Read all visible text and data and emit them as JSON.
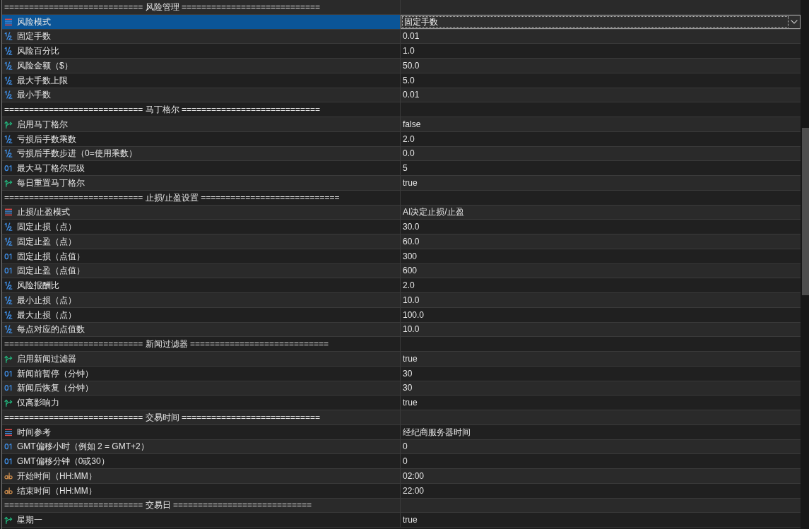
{
  "table": {
    "rows": [
      {
        "kind": "header",
        "label": "============================ 风险管理 ============================",
        "selected": false
      },
      {
        "kind": "enum",
        "label": "风险模式",
        "value": "固定手数",
        "selected": true
      },
      {
        "kind": "double",
        "label": "固定手数",
        "value": "0.01",
        "selected": false
      },
      {
        "kind": "double",
        "label": "风险百分比",
        "value": "1.0",
        "selected": false
      },
      {
        "kind": "double",
        "label": "风险金额（$）",
        "value": "50.0",
        "selected": false
      },
      {
        "kind": "double",
        "label": "最大手数上限",
        "value": "5.0",
        "selected": false
      },
      {
        "kind": "double",
        "label": "最小手数",
        "value": "0.01",
        "selected": false
      },
      {
        "kind": "header",
        "label": "============================ 马丁格尔 ============================",
        "selected": false
      },
      {
        "kind": "bool",
        "label": "启用马丁格尔",
        "value": "false",
        "selected": false
      },
      {
        "kind": "double",
        "label": "亏损后手数乘数",
        "value": "2.0",
        "selected": false
      },
      {
        "kind": "double",
        "label": "亏损后手数步进（0=使用乘数）",
        "value": "0.0",
        "selected": false
      },
      {
        "kind": "int",
        "label": "最大马丁格尔层级",
        "value": "5",
        "selected": false
      },
      {
        "kind": "bool",
        "label": "每日重置马丁格尔",
        "value": "true",
        "selected": false
      },
      {
        "kind": "header",
        "label": "============================ 止损/止盈设置 ============================",
        "selected": false
      },
      {
        "kind": "enum",
        "label": "止损/止盈模式",
        "value": "AI决定止损/止盈",
        "selected": false
      },
      {
        "kind": "double",
        "label": "固定止损（点）",
        "value": "30.0",
        "selected": false
      },
      {
        "kind": "double",
        "label": "固定止盈（点）",
        "value": "60.0",
        "selected": false
      },
      {
        "kind": "int",
        "label": "固定止损（点值）",
        "value": "300",
        "selected": false
      },
      {
        "kind": "int",
        "label": "固定止盈（点值）",
        "value": "600",
        "selected": false
      },
      {
        "kind": "double",
        "label": "风险报酬比",
        "value": "2.0",
        "selected": false
      },
      {
        "kind": "double",
        "label": "最小止损（点）",
        "value": "10.0",
        "selected": false
      },
      {
        "kind": "double",
        "label": "最大止损（点）",
        "value": "100.0",
        "selected": false
      },
      {
        "kind": "double",
        "label": "每点对应的点值数",
        "value": "10.0",
        "selected": false
      },
      {
        "kind": "header",
        "label": "============================ 新闻过滤器 ============================",
        "selected": false
      },
      {
        "kind": "bool",
        "label": "启用新闻过滤器",
        "value": "true",
        "selected": false
      },
      {
        "kind": "int",
        "label": "新闻前暂停（分钟）",
        "value": "30",
        "selected": false
      },
      {
        "kind": "int",
        "label": "新闻后恢复（分钟）",
        "value": "30",
        "selected": false
      },
      {
        "kind": "bool",
        "label": "仅高影响力",
        "value": "true",
        "selected": false
      },
      {
        "kind": "header",
        "label": "============================ 交易时间 ============================",
        "selected": false
      },
      {
        "kind": "enum",
        "label": "时间参考",
        "value": "经纪商服务器时间",
        "selected": false
      },
      {
        "kind": "int",
        "label": "GMT偏移小时（例如 2 = GMT+2）",
        "value": "0",
        "selected": false
      },
      {
        "kind": "int",
        "label": "GMT偏移分钟（0或30）",
        "value": "0",
        "selected": false
      },
      {
        "kind": "string",
        "label": "开始时间（HH:MM）",
        "value": "02:00",
        "selected": false
      },
      {
        "kind": "string",
        "label": "结束时间（HH:MM）",
        "value": "22:00",
        "selected": false
      },
      {
        "kind": "header",
        "label": "============================ 交易日 ============================",
        "selected": false
      },
      {
        "kind": "bool",
        "label": "星期一",
        "value": "true",
        "selected": false
      }
    ]
  }
}
